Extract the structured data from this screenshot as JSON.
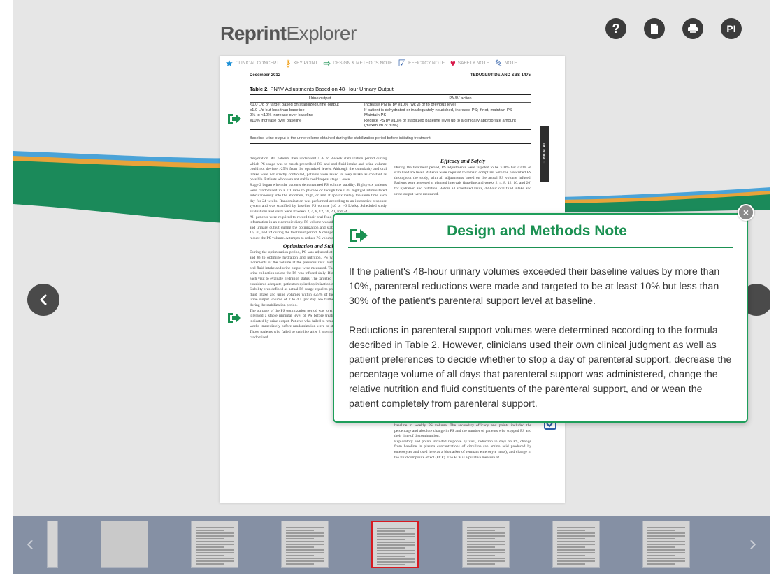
{
  "app": {
    "logo_bold": "Reprint",
    "logo_light": "Explorer",
    "top_buttons": [
      {
        "label": "?",
        "icon": "help-icon"
      },
      {
        "label": "",
        "icon": "document-icon"
      },
      {
        "label": "",
        "icon": "print-icon"
      },
      {
        "label": "PI",
        "icon": "pi-icon"
      }
    ]
  },
  "legend": [
    {
      "label": "CLINICAL CONCEPT",
      "icon": "star-icon",
      "color": "#1a8fd6"
    },
    {
      "label": "KEY POINT",
      "icon": "key-icon",
      "color": "#f0a21e"
    },
    {
      "label": "DESIGN & METHODS NOTE",
      "icon": "arrow-box-icon",
      "color": "#1b9152"
    },
    {
      "label": "EFFICACY NOTE",
      "icon": "checkbox-icon",
      "color": "#2d5da8"
    },
    {
      "label": "SAFETY NOTE",
      "icon": "heart-icon",
      "color": "#d81b4c"
    },
    {
      "label": "NOTE",
      "icon": "pencil-icon",
      "color": "#2d5da8"
    }
  ],
  "page": {
    "header_left": "December 2012",
    "header_right": "TEDUGLUTIDE AND SBS   1475",
    "table_title_bold": "Table 2.",
    "table_title": " PN/IV Adjustments Based on 48-Hour Urinary Output",
    "table_headers": [
      "Urine output",
      "PN/IV action"
    ],
    "table_rows": [
      [
        "<1.0 L/d or target based on stabilized urine output",
        "Increase PN/IV by ≥10% (wk 2) or to previous level"
      ],
      [
        "≥1.0 L/d but less than baseline",
        "If patient is dehydrated or inadequately nourished, increase PS; if not, maintain PS"
      ],
      [
        "0% to <10% increase over baseline",
        "Maintain PS"
      ],
      [
        "≥10% increase over baseline",
        "Reduce PS by ≥10% of stabilized baseline level up to a clinically appropriate amount (maximum of 30%)"
      ]
    ],
    "table_footnote": "Baseline urine output is the urine volume obtained during the stabilization period before initiating treatment.",
    "side_tab": "CLINICAL AT",
    "col_left_1": "dehydration. All patients then underwent a 4- to 8-week stabilization period during which PS usage was to match prescribed PS, and oral fluid intake and urine volume could not deviate >25% from the optimized levels. Although the osmolarity and oral intake were not strictly controlled, patients were asked to keep intake as constant as possible. Patients who were not stable could repeat stage 1 once.",
    "col_left_2": "Stage 2 began when the patients demonstrated PS volume stability. Eighty-six patients were randomized in a 1:1 ratio to placebo or teduglutide 0.05 mg/kg/d administered subcutaneously into the abdomen, thigh, or arm at approximately the same time each day for 24 weeks. Randomization was performed according to an interactive response system and was stratified by baseline PS volume (≤6 or >6 L/wk). Scheduled study evaluations and visits were at weeks 2, 4, 8, 12, 16, 20, and 24.",
    "col_left_3": "All patients were required to record their oral fluid intake and urinary output, and all information in an electronic diary. PS volume was adjusted on 48 hour oral fluid intake and urinary output during the optimization and stabilization period and weeks 8, 12, 16, 20, and 24 during the treatment period. A change in oral intake, the clinician could reduce the PS volume. Attempts to reduce PS volume at each visit before week 24.",
    "left_heading": "Optimization and Stabilization",
    "col_left_4": "During the optimization period, PS was adjusted at planned intervals (weeks 2, 4, 6, and 8) to optimize hydration and nutrition. PS was adjusted in target amounts or increments of the volume at the previous visit. Before each scheduled visit, 48-hour oral fluid intake and urine output were measured. The measurement included a 48-hour urine collection unless the PS was infused daily. Blood samples were also collected at each visit to evaluate hydration status. The targeted urine output of 1.0 to 2.0 L/d was considered adequate; patients required optimization or control during this period.",
    "col_left_5": "Stability was defined as actual PS usage equal to prescribed PS, baseline 48-hour oral fluid intake and urine volumes within ±25% of the respective mean and a baseline urine output volume of 2 to 4 L per day. No further PS adjustments were permitted during the stabilization period.",
    "col_left_6": "The purpose of the PS optimization period was to ensure that all patients received and tolerated a stable minimal level of PS before treatment, with adequate hydration as indicated by urine output. Patients who failed to remain stable for at least 4 consecutive weeks immediately before randomization were to start the optimization period again. Those patients who failed to stabilize after 2 attempts could not proceed and were not randomized.",
    "right_heading": "Efficacy and Safety",
    "col_right_1": "During the treatment period, PS adjustments were targeted to be ≥10% but <30% of stabilized PS level. Patients were required to remain compliant with the prescribed PS throughout the study, with all adjustments based on the actual PS volume infused. Patients were assessed at planned intervals (baseline and weeks 2, 4, 8, 12, 16, and 20) for hydration and nutrition. Before all scheduled visits, 48-hour oral fluid intake and urine output were measured.",
    "col_right_2": "baseline in weekly PS volume. The secondary efficacy end points included the percentage and absolute change in PS and the number of patients who stopped PS and their time of discontinuation.",
    "col_right_3": "Exploratory end points included response by visit, reduction in days on PS, change from baseline in plasma concentrations of citrulline (an amino acid produced by enterocytes and used here as a biomarker of remnant enterocyte mass), and change in the fluid composite effect (FCE). The FCE is a putative measure of"
  },
  "popup": {
    "title": "Design and Methods Note",
    "paragraph_1": "If the patient's 48-hour urinary volumes exceeded their baseline values by more than 10%, parenteral reductions were made and targeted to be at least 10% but less than 30% of the patient's parenteral support level at baseline.",
    "paragraph_2": "Reductions in parenteral support volumes were determined according to the formula described in Table 2. However, clinicians used their own clinical judgment as well as patient preferences to decide whether to stop a day of parenteral support, decrease the percentage volume of all days that parenteral support was administered, change the relative nutrition and fluid constituents of the parenteral support, and or wean the patient completely from parenteral support.",
    "close_label": "×",
    "accent": "#1b9152"
  },
  "thumbnails": {
    "count": 8,
    "active_index": 4
  }
}
